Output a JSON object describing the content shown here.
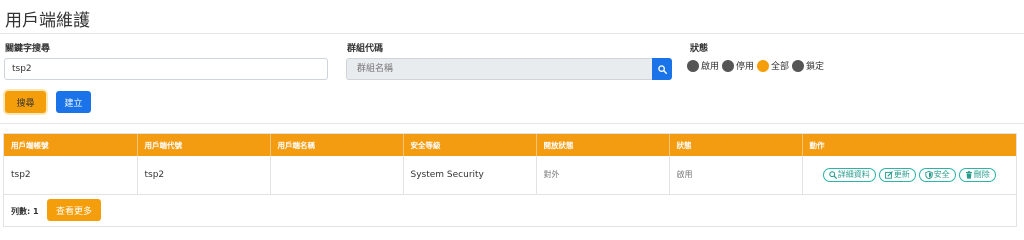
{
  "page": {
    "title": "用戶端維護"
  },
  "filters": {
    "keyword_label": "關鍵字搜尋",
    "keyword_value": "tsp2",
    "group_label": "群組代碼",
    "group_placeholder": "群組名稱",
    "status_label": "狀態",
    "status_options": [
      {
        "label": "啟用",
        "checked": false
      },
      {
        "label": "停用",
        "checked": false
      },
      {
        "label": "全部",
        "checked": true
      },
      {
        "label": "鎖定",
        "checked": false
      }
    ]
  },
  "buttons": {
    "search": "搜尋",
    "create": "建立",
    "more": "查看更多"
  },
  "table": {
    "headers": [
      "用戶端帳號",
      "用戶端代號",
      "用戶端名稱",
      "安全等級",
      "開放狀態",
      "狀態",
      "動作"
    ],
    "rows": [
      {
        "account": "tsp2",
        "code": "tsp2",
        "name": "",
        "security": "System Security",
        "open_status": "對外",
        "status": "啟用",
        "actions": {
          "detail": "詳細資料",
          "update": "更新",
          "security": "安全",
          "delete": "刪除"
        }
      }
    ]
  },
  "footer": {
    "count_text": "列數: 1"
  },
  "colors": {
    "accent": "#f59e0b",
    "primary": "#1a73e8",
    "action": "#2a9d8f"
  },
  "icons": {
    "group_search": "search-icon",
    "detail": "search-icon",
    "update": "edit-icon",
    "security": "shield-icon",
    "delete": "trash-icon"
  }
}
